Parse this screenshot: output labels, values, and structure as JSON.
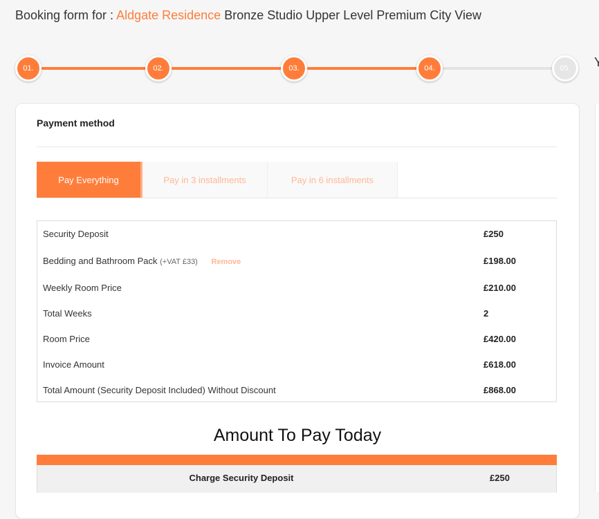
{
  "header": {
    "prefix": "Booking form for :",
    "property": "Aldgate Residence",
    "room": "Bronze Studio Upper Level Premium City View"
  },
  "stepper": {
    "steps": [
      "01.",
      "02.",
      "03.",
      "04.",
      "05."
    ],
    "current_step": 4,
    "clipped_right_text": "Y"
  },
  "payment": {
    "section_title": "Payment method",
    "tabs": [
      "Pay Everything",
      "Pay in 3 installments",
      "Pay in 6 installments"
    ],
    "active_tab": "Pay Everything",
    "rows": [
      {
        "label": "Security Deposit",
        "value": "£250"
      },
      {
        "label": "Bedding and Bathroom Pack",
        "vat_note": "(+VAT £33)",
        "action": "Remove",
        "value": "£198.00"
      },
      {
        "label": "Weekly Room Price",
        "value": "£210.00"
      },
      {
        "label": "Total Weeks",
        "value": "2"
      },
      {
        "label": "Room Price",
        "value": "£420.00"
      },
      {
        "label": "Invoice Amount",
        "value": "£618.00"
      },
      {
        "label": "Total Amount (Security Deposit Included) Without Discount",
        "value": "£868.00"
      }
    ]
  },
  "amount_today": {
    "title": "Amount To Pay Today",
    "charge_label": "Charge Security Deposit",
    "charge_value": "£250"
  },
  "colors": {
    "accent": "#ff7d3a",
    "accent_light": "#ffb794",
    "inactive_step": "#e6e6e6"
  }
}
